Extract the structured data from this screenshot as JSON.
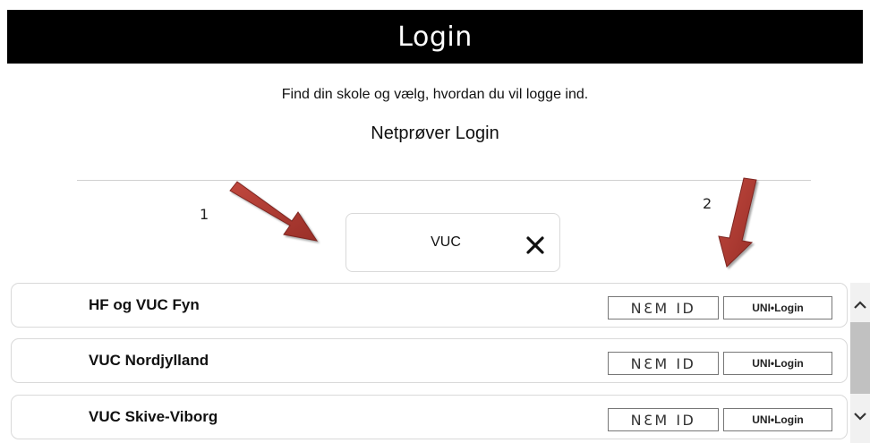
{
  "header": {
    "title": "Login"
  },
  "intro": {
    "instruction": "Find din skole og vælg, hvordan du vil logge ind.",
    "subtitle": "Netprøver Login"
  },
  "annotations": {
    "marker_1": "1",
    "marker_2": "2",
    "arrow_color": "#b03a32"
  },
  "search": {
    "value": "VUC",
    "clear_icon": "close-icon"
  },
  "schools": [
    {
      "name": "HF og VUC Fyn",
      "nemid_label": "NƐM ID",
      "unilogin_label": "UNI•Login"
    },
    {
      "name": "VUC Nordjylland",
      "nemid_label": "NƐM ID",
      "unilogin_label": "UNI•Login"
    },
    {
      "name": "VUC Skive-Viborg",
      "nemid_label": "NƐM ID",
      "unilogin_label": "UNI•Login"
    }
  ],
  "scrollbar": {
    "up_icon": "chevron-up-icon",
    "down_icon": "chevron-down-icon"
  }
}
